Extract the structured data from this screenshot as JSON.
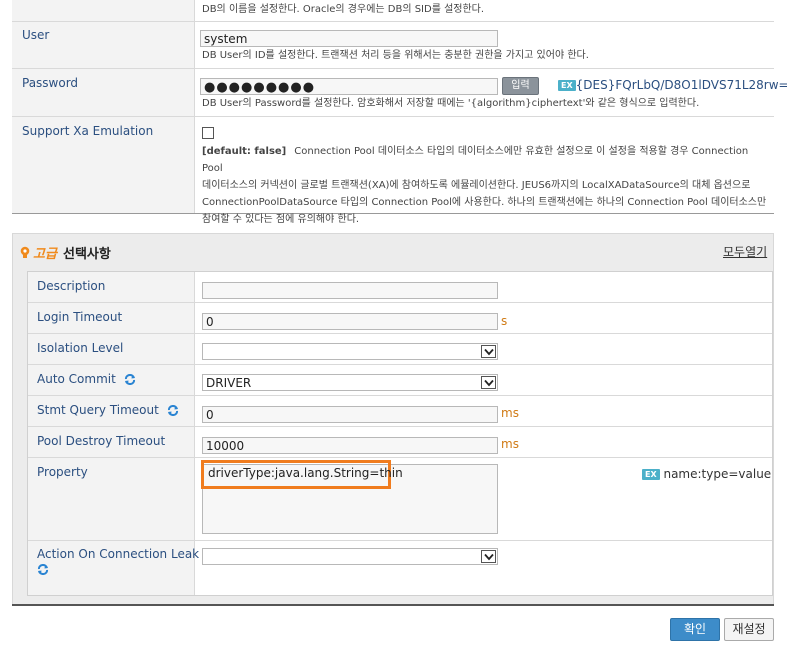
{
  "basic": {
    "top_desc": "DB의 이름을 설정한다. Oracle의 경우에는 DB의 SID를 설정한다.",
    "user": {
      "label": "User",
      "value": "system",
      "desc": "DB User의 ID를 설정한다. 트랜잭션 처리 등을 위해서는 충분한 권한을 가지고 있어야 한다."
    },
    "password": {
      "label": "Password",
      "value": "●●●●●●●●●",
      "button": "입력",
      "ex_badge": "EX",
      "example": "{DES}FQrLbQ/D8O1lDVS71L28rw==",
      "desc": "DB User의 Password를 설정한다. 암호화해서 저장할 때에는 '{algorithm}ciphertext'와 같은 형식으로 입력한다."
    },
    "xa": {
      "label": "Support Xa Emulation",
      "default": "[default: false]",
      "desc_line1": "Connection Pool 데이터소스 타입의 데이터소스에만 유효한 설정으로 이 설정을 적용할 경우 Connection Pool",
      "desc_line2": "데이터소스의 커넥션이 글로벌 트랜잭션(XA)에 참여하도록 에뮬레이션한다. JEUS6까지의 LocalXADataSource의 대체 옵션으로",
      "desc_line3": "ConnectionPoolDataSource 타입의 Connection Pool에 사용한다. 하나의 트랜잭션에는 하나의 Connection Pool 데이터소스만",
      "desc_line4": "참여할 수 있다는 점에 유의해야 한다."
    }
  },
  "advanced": {
    "title_em": "고급",
    "title": "선택사항",
    "expand_all": "모두열기",
    "fields": {
      "description": {
        "label": "Description",
        "value": ""
      },
      "login_timeout": {
        "label": "Login Timeout",
        "value": "0",
        "unit": "s"
      },
      "isolation_level": {
        "label": "Isolation Level",
        "value": ""
      },
      "auto_commit": {
        "label": "Auto Commit",
        "value": "DRIVER"
      },
      "stmt_query_timeout": {
        "label": "Stmt Query Timeout",
        "value": "0",
        "unit": "ms"
      },
      "pool_destroy_timeout": {
        "label": "Pool Destroy Timeout",
        "value": "10000",
        "unit": "ms"
      },
      "property": {
        "label": "Property",
        "value": "driverType:java.lang.String=thin",
        "ex_badge": "EX",
        "example": "name:type=value"
      },
      "action_on_leak": {
        "label": "Action On Connection Leak",
        "value": ""
      }
    }
  },
  "footer": {
    "confirm": "확인",
    "reset": "재설정"
  },
  "colors": {
    "label_blue": "#2b4f80",
    "unit_orange": "#d07a14",
    "highlight_orange": "#f07c1e",
    "refresh_blue": "#2a84d2",
    "confirm_button": "#3d8cc9",
    "ex_badge": "#4bb0c9"
  }
}
